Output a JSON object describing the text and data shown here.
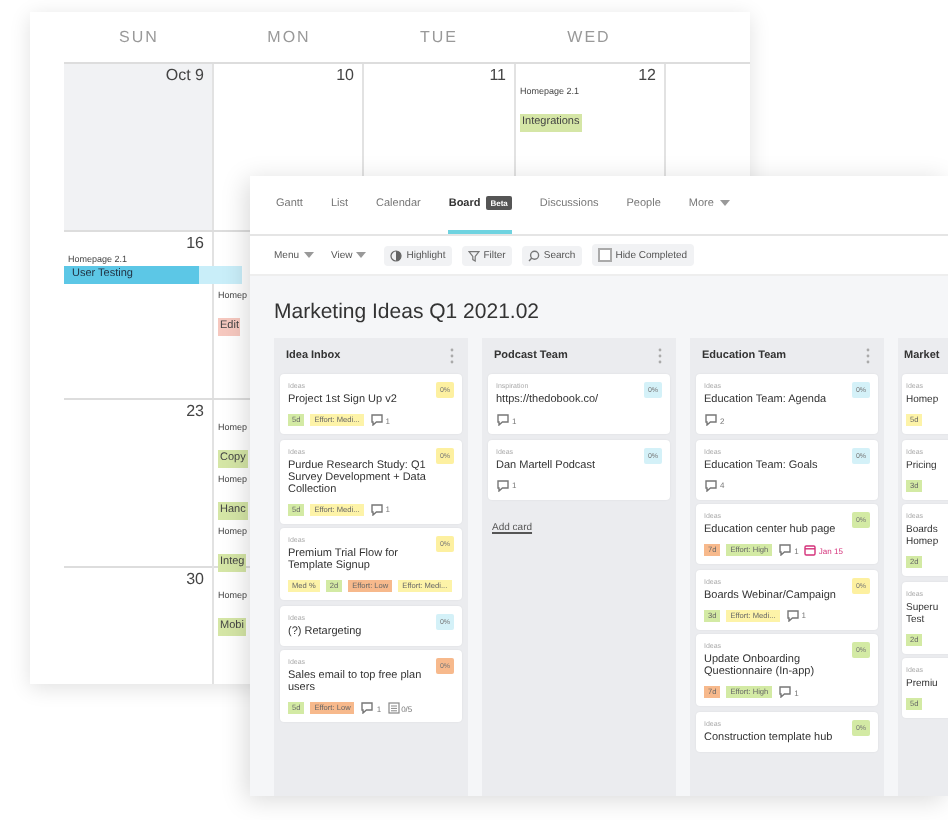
{
  "calendar": {
    "days": [
      "SUN",
      "MON",
      "TUE",
      "WED"
    ],
    "weeks": [
      {
        "days": [
          {
            "date": "Oct 9",
            "past": true
          },
          {
            "date": "10",
            "past": false
          },
          {
            "date": "11",
            "past": false
          },
          {
            "date": "12",
            "past": false,
            "events": [
              {
                "kind": "single",
                "project": "Homepage 2.1",
                "title": "Integrations",
                "color": "#d5e6a6"
              }
            ]
          }
        ]
      },
      {
        "days": [
          {
            "date": "16",
            "events": [
              {
                "kind": "multi-day",
                "project": "Homepage 2.1",
                "title": "User Testing",
                "color": "#5cc7e6"
              }
            ]
          },
          {
            "events": [
              {
                "kind": "single",
                "project": "Homep",
                "title": "Edit",
                "color": "#f6c8bf"
              }
            ]
          }
        ]
      },
      {
        "days": [
          {
            "date": "23"
          },
          {
            "events": [
              {
                "kind": "single",
                "project": "Homep",
                "title": "Copy",
                "color": "#d5e6a6"
              },
              {
                "kind": "single",
                "project": "Homep",
                "title": "Hanc",
                "color": "#d5e6a6"
              },
              {
                "kind": "single",
                "project": "Homep",
                "title": "Integ",
                "color": "#d5e6a6"
              }
            ]
          }
        ]
      },
      {
        "days": [
          {
            "date": "30"
          },
          {
            "events": [
              {
                "kind": "single",
                "project": "Homep",
                "title": "Mobi",
                "color": "#d5e6a6"
              }
            ]
          }
        ]
      }
    ]
  },
  "board": {
    "tabs": [
      {
        "label": "Gantt",
        "selected": false
      },
      {
        "label": "List",
        "selected": false
      },
      {
        "label": "Calendar",
        "selected": false
      },
      {
        "label": "Board",
        "badge": "Beta",
        "selected": true
      },
      {
        "label": "Discussions",
        "selected": false
      },
      {
        "label": "People",
        "selected": false
      },
      {
        "label": "More",
        "dropdown": true,
        "selected": false
      }
    ],
    "toolbar": [
      {
        "kind": "dropdown",
        "label": "Menu"
      },
      {
        "kind": "dropdown",
        "label": "View"
      },
      {
        "kind": "highlight",
        "label": "Highlight"
      },
      {
        "kind": "filter",
        "label": "Filter"
      },
      {
        "kind": "search",
        "label": "Search"
      },
      {
        "kind": "checkbox",
        "label": "Hide Completed",
        "checked": false
      }
    ],
    "title": "Marketing Ideas Q1 2021.02",
    "columns": [
      {
        "name": "Idea Inbox",
        "menu": true,
        "cards": [
          {
            "category": "Ideas",
            "title": "Project 1st Sign Up v2",
            "progress": "0%",
            "color": "#fdf0a0",
            "tags": [
              {
                "text": "5d",
                "color": "#d3eaa4"
              },
              {
                "text": "Effort: Medi...",
                "color": "#fdf3a8"
              }
            ],
            "comments": "1"
          },
          {
            "category": "Ideas",
            "title": "Purdue Research Study: Q1 Survey Development + Data Collection",
            "progress": "0%",
            "color": "#fdf0a0",
            "tags": [
              {
                "text": "5d",
                "color": "#d3eaa4"
              },
              {
                "text": "Effort: Medi...",
                "color": "#fdf3a8"
              }
            ],
            "comments": "1"
          },
          {
            "category": "Ideas",
            "title": "Premium Trial Flow for Template Signup",
            "progress": "0%",
            "color": "#fdf0a0",
            "tags": [
              {
                "text": "Med %",
                "color": "#fdf3a8"
              },
              {
                "text": "2d",
                "color": "#d3eaa4"
              },
              {
                "text": "Effort: Low",
                "color": "#f7b98c"
              },
              {
                "text": "Effort: Medi...",
                "color": "#fdf3a8"
              }
            ]
          },
          {
            "category": "Ideas",
            "title": "(?) Retargeting",
            "progress": "0%",
            "color": "#d4f1f8"
          },
          {
            "category": "Ideas",
            "title": "Sales email to top free plan users",
            "progress": "0%",
            "color": "#f7b98c",
            "tags": [
              {
                "text": "5d",
                "color": "#d3eaa4"
              },
              {
                "text": "Effort: Low",
                "color": "#f7b98c"
              }
            ],
            "comments": "1",
            "checklist": "0/5"
          }
        ]
      },
      {
        "name": "Podcast Team",
        "menu": true,
        "cards": [
          {
            "category": "Inspiration",
            "title": "https://thedobook.co/",
            "progress": "0%",
            "color": "#d4f1f8",
            "comments": "1"
          },
          {
            "category": "Ideas",
            "title": "Dan Martell Podcast",
            "progress": "0%",
            "color": "#d4f1f8",
            "comments": "1"
          }
        ],
        "add_card": "Add card"
      },
      {
        "name": "Education Team",
        "menu": true,
        "cards": [
          {
            "category": "Ideas",
            "title": "Education Team: Agenda",
            "progress": "0%",
            "color": "#d4f1f8",
            "comments": "2"
          },
          {
            "category": "Ideas",
            "title": "Education Team: Goals",
            "progress": "0%",
            "color": "#d4f1f8",
            "comments": "4"
          },
          {
            "category": "Ideas",
            "title": "Education center hub page",
            "progress": "0%",
            "color": "#d3eaa4",
            "tags": [
              {
                "text": "7d",
                "color": "#f7b98c"
              },
              {
                "text": "Effort: High",
                "color": "#d3eaa4"
              }
            ],
            "comments": "1",
            "due": "Jan 15"
          },
          {
            "category": "Ideas",
            "title": "Boards Webinar/Campaign",
            "progress": "0%",
            "color": "#fdf0a0",
            "tags": [
              {
                "text": "3d",
                "color": "#d3eaa4"
              },
              {
                "text": "Effort: Medi...",
                "color": "#fdf3a8"
              }
            ],
            "comments": "1"
          },
          {
            "category": "Ideas",
            "title": "Update Onboarding Questionnaire (In-app)",
            "progress": "0%",
            "color": "#d3eaa4",
            "tags": [
              {
                "text": "7d",
                "color": "#f7b98c"
              },
              {
                "text": "Effort: High",
                "color": "#d3eaa4"
              }
            ],
            "comments": "1"
          },
          {
            "category": "Ideas",
            "title": "Construction template hub",
            "progress": "0%",
            "color": "#d3eaa4"
          }
        ]
      },
      {
        "name": "Market",
        "cards": [
          {
            "category": "Ideas",
            "title": "Homep",
            "tags": [
              {
                "text": "5d",
                "color": "#fdf3a8"
              }
            ]
          },
          {
            "category": "Ideas",
            "title": "Pricing",
            "tags": [
              {
                "text": "3d",
                "color": "#d3eaa4"
              }
            ]
          },
          {
            "category": "Ideas",
            "title": "Boards Homep",
            "tags": [
              {
                "text": "2d",
                "color": "#d3eaa4"
              }
            ]
          },
          {
            "category": "Ideas",
            "title": "Superu Test",
            "tags": [
              {
                "text": "2d",
                "color": "#d3eaa4"
              }
            ]
          },
          {
            "category": "Ideas",
            "title": "Premiu",
            "tags": [
              {
                "text": "5d",
                "color": "#d3eaa4"
              }
            ]
          }
        ]
      }
    ]
  }
}
